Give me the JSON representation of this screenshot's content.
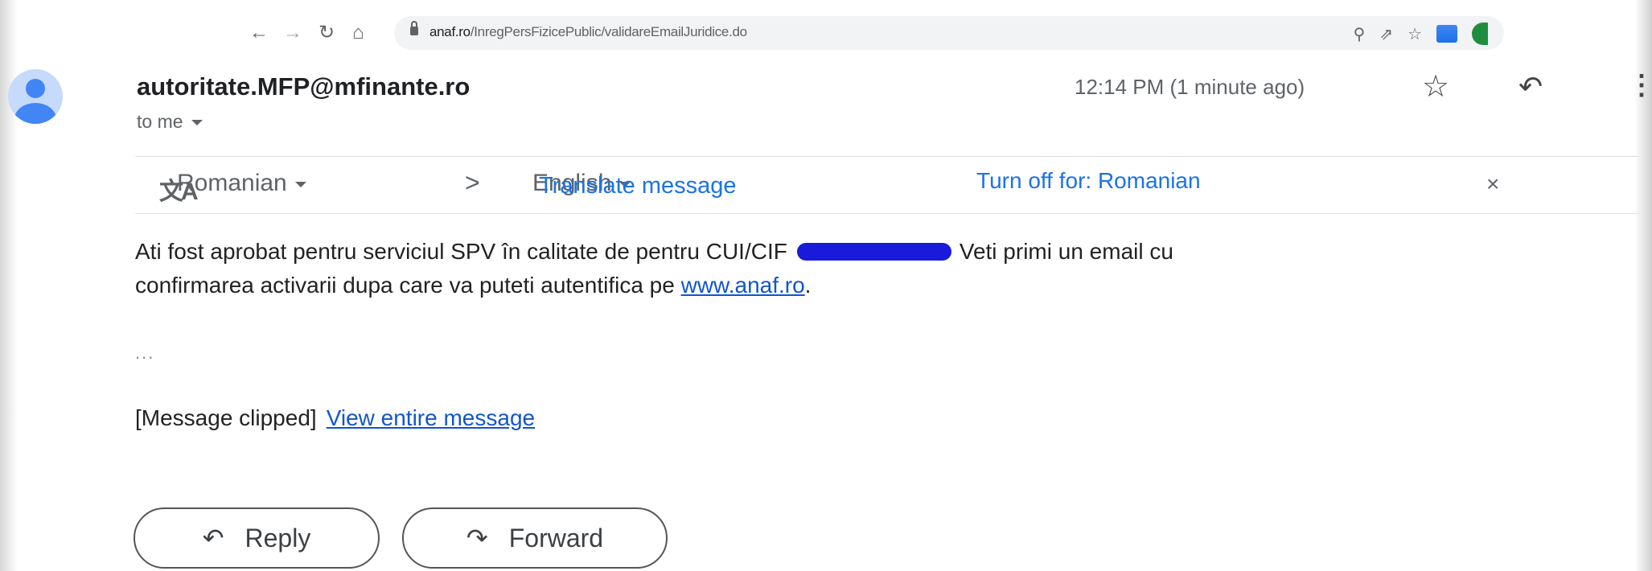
{
  "browser": {
    "back_icon": "arrow-left-icon",
    "forward_icon": "arrow-right-icon",
    "reload_icon": "reload-icon",
    "home_icon": "home-icon",
    "url_domain": "anaf.ro",
    "url_path": "/InregPersFizicePublic/validareEmailJuridice.do"
  },
  "email": {
    "sender": "autoritate.MFP@mfinante.ro",
    "to": "to me",
    "time": "12:14 PM (1 minute ago)"
  },
  "translate": {
    "source_lang": "Romanian",
    "target_lang": "English",
    "translate_label": "Translate message",
    "turn_off_label": "Turn off for: Romanian"
  },
  "body": {
    "line1_before": "Ati fost aprobat pentru serviciul SPV în calitate de  pentru CUI/CIF",
    "line1_after": "Veti primi un email cu",
    "line2_before": "confirmarea activarii dupa care va puteti autentifica pe",
    "link": "www.anaf.ro",
    "line2_after": ".",
    "ellipsis": "...",
    "clipped_label": "[Message clipped]",
    "view_entire": "View entire message"
  },
  "actions": {
    "reply_label": "Reply",
    "forward_label": "Forward"
  },
  "colors": {
    "link": "#1155cc",
    "translate_link": "#1a73e8",
    "avatar": "#4285f4",
    "redaction": "#1a1adb"
  }
}
